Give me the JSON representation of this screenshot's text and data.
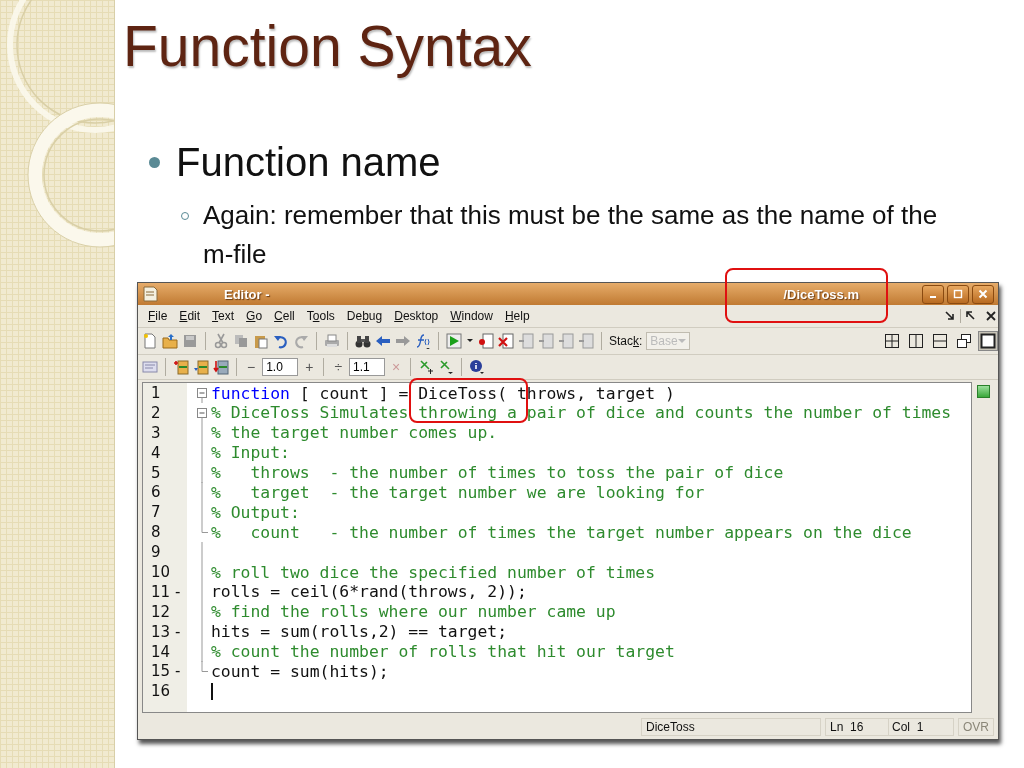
{
  "slide": {
    "title": "Function Syntax",
    "bullets": [
      {
        "text": "Function name",
        "children": [
          {
            "text": "Again: remember that this must be the same as the name of the m-file"
          }
        ]
      }
    ]
  },
  "editor": {
    "window": {
      "title": "Editor - ",
      "file": "/DiceToss.m"
    },
    "menu": [
      {
        "key": "F",
        "after": "ile"
      },
      {
        "key": "E",
        "after": "dit"
      },
      {
        "key": "T",
        "after": "ext"
      },
      {
        "key": "G",
        "after": "o"
      },
      {
        "key": "C",
        "after": "ell"
      },
      {
        "before": "T",
        "key": "o",
        "after": "ols"
      },
      {
        "before": "De",
        "key": "b",
        "after": "ug"
      },
      {
        "key": "D",
        "after": "esktop"
      },
      {
        "key": "W",
        "after": "indow"
      },
      {
        "key": "H",
        "after": "elp"
      }
    ],
    "toolbar": {
      "stack_label": {
        "before": "Stac",
        "key": "k",
        "after": ":"
      },
      "stack_value": "Base",
      "stack_disabled": true,
      "layouts": [
        {
          "selected": false
        },
        {
          "selected": false
        },
        {
          "selected": false
        },
        {
          "selected": false
        },
        {
          "selected": true
        }
      ]
    },
    "cell_toolbar": {
      "minus": "−",
      "field_1": "1.0",
      "plus": "+",
      "divide": "÷",
      "field_2": "1.1",
      "times": "×"
    },
    "lines": [
      {
        "number": "1",
        "kind": "fold_start",
        "segments": [
          {
            "kind": "keyword",
            "text": "function"
          },
          {
            "kind": "plain",
            "text": " [ count ] = DiceToss( throws, target )"
          }
        ]
      },
      {
        "number": "2",
        "kind": "fold_start",
        "segments": [
          {
            "kind": "comment",
            "text": "% DiceToss Simulates throwing a pair of dice and counts the number of times"
          }
        ]
      },
      {
        "number": "3",
        "kind": "in_fold",
        "segments": [
          {
            "kind": "comment",
            "text": "% the target number comes up."
          }
        ]
      },
      {
        "number": "4",
        "kind": "in_fold",
        "segments": [
          {
            "kind": "comment",
            "text": "% Input:"
          }
        ]
      },
      {
        "number": "5",
        "kind": "in_fold",
        "segments": [
          {
            "kind": "comment",
            "text": "%   throws  - the number of times to toss the pair of dice"
          }
        ]
      },
      {
        "number": "6",
        "kind": "in_fold",
        "segments": [
          {
            "kind": "comment",
            "text": "%   target  - the target number we are looking for"
          }
        ]
      },
      {
        "number": "7",
        "kind": "in_fold",
        "segments": [
          {
            "kind": "comment",
            "text": "% Output:"
          }
        ]
      },
      {
        "number": "8",
        "kind": "fold_end",
        "segments": [
          {
            "kind": "comment",
            "text": "%   count   - the number of times the target number appears on the dice"
          }
        ]
      },
      {
        "number": "9",
        "kind": "in_fold"
      },
      {
        "number": "10",
        "kind": "in_fold",
        "segments": [
          {
            "kind": "comment",
            "text": "% roll two dice the specified number of times"
          }
        ]
      },
      {
        "number": "11",
        "marker": "-",
        "kind": "in_fold",
        "segments": [
          {
            "kind": "plain",
            "text": "rolls = ceil(6*rand(throws, 2));"
          }
        ]
      },
      {
        "number": "12",
        "kind": "in_fold",
        "segments": [
          {
            "kind": "comment",
            "text": "% find the rolls where our number came up"
          }
        ]
      },
      {
        "number": "13",
        "marker": "-",
        "kind": "in_fold",
        "segments": [
          {
            "kind": "plain",
            "text": "hits = sum(rolls,2) == target;"
          }
        ]
      },
      {
        "number": "14",
        "kind": "in_fold",
        "segments": [
          {
            "kind": "comment",
            "text": "% count the number of rolls that hit our target"
          }
        ]
      },
      {
        "number": "15",
        "marker": "-",
        "kind": "fold_end",
        "segments": [
          {
            "kind": "plain",
            "text": "count = sum(hits);"
          }
        ]
      },
      {
        "number": "16",
        "kind": "plain",
        "cursor": true
      }
    ],
    "status_bar": {
      "function": "DiceToss",
      "line": "Ln  16",
      "col": "Col  1",
      "ovr": "OVR",
      "ovr_active": false
    }
  }
}
